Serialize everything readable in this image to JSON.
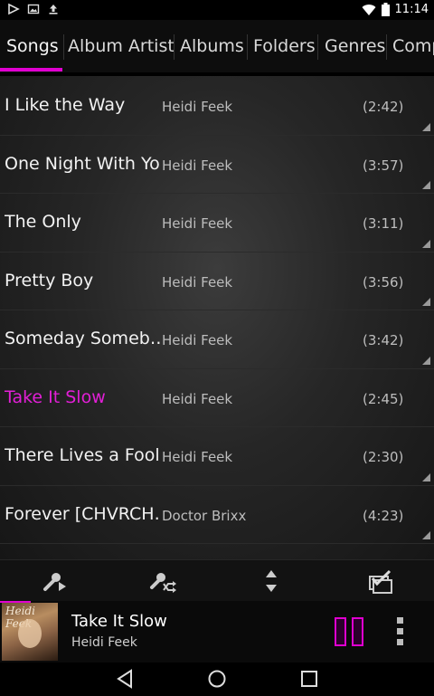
{
  "status_bar": {
    "left_icons": [
      "play-store-icon",
      "image-icon",
      "upload-icon"
    ],
    "right_icons": [
      "wifi-icon",
      "battery-icon"
    ],
    "time": "11:14"
  },
  "tabs": [
    {
      "label": "Songs",
      "active": true
    },
    {
      "label": "Album Artist"
    },
    {
      "label": "Albums"
    },
    {
      "label": "Folders"
    },
    {
      "label": "Genres"
    },
    {
      "label": "Comp"
    }
  ],
  "songs": [
    {
      "title": "I Like the Way",
      "artist": "Heidi Feek",
      "duration": "(2:42)"
    },
    {
      "title": "One Night With You",
      "artist": "Heidi Feek",
      "duration": "(3:57)"
    },
    {
      "title": "The Only",
      "artist": "Heidi Feek",
      "duration": "(3:11)"
    },
    {
      "title": "Pretty Boy",
      "artist": "Heidi Feek",
      "duration": "(3:56)"
    },
    {
      "title": "Someday Someb…",
      "artist": "Heidi Feek",
      "duration": "(3:42)"
    },
    {
      "title": "Take It Slow",
      "artist": "Heidi Feek",
      "duration": "(2:45)",
      "playing": true
    },
    {
      "title": "There Lives a Fool",
      "artist": "Heidi Feek",
      "duration": "(2:30)"
    },
    {
      "title": "Forever [CHVRCH…",
      "artist": "Doctor Brixx",
      "duration": "(4:23)"
    }
  ],
  "toolbar": {
    "icons": [
      "play-artist-icon",
      "shuffle-artist-icon",
      "sort-icon",
      "select-all-icon"
    ]
  },
  "now_playing": {
    "album_art_text": "Heidi Feek",
    "title": "Take It Slow",
    "artist": "Heidi Feek",
    "progress_fraction": 0.07
  },
  "nav_bar": {
    "icons": [
      "back-icon",
      "home-icon",
      "recents-icon"
    ]
  },
  "colors": {
    "accent": "#e000d0",
    "playing_text": "#e21fd6",
    "background": "#262626"
  }
}
